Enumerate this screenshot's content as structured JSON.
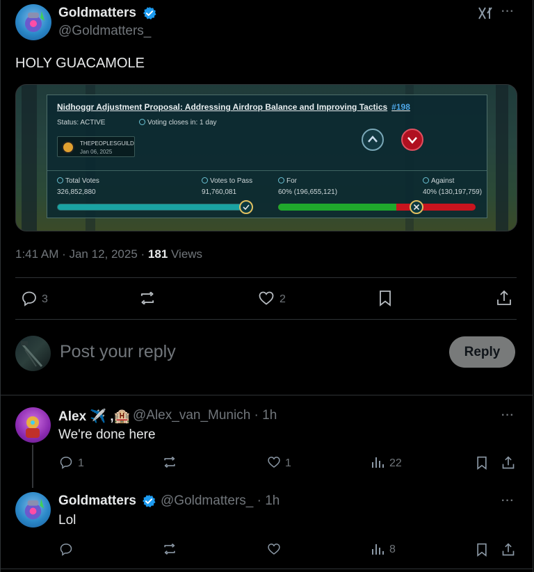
{
  "post": {
    "author_name": "Goldmatters",
    "author_handle": "@Goldmatters_",
    "text": "HOLY GUACAMOLE",
    "time": "1:41 AM · Jan 12, 2025 · ",
    "views_count": "181",
    "views_label": " Views",
    "replies": "3",
    "reposts": "",
    "likes": "2"
  },
  "proposal_card": {
    "title": "Nidhoggr Adjustment Proposal: Addressing Airdrop Balance and Improving Tactics",
    "number": "#198",
    "status": "Status: ACTIVE",
    "voting_closes": "Voting closes in: 1 day",
    "guild_name": "THEPEOPLESGUILD",
    "guild_date": "Jan 06, 2025",
    "total_votes_label": "Total Votes",
    "total_votes": "326,852,880",
    "votes_to_pass_label": "Votes to Pass",
    "votes_to_pass": "91,760,081",
    "for_label": "For",
    "for_value": "60% (196,655,121)",
    "against_label": "Against",
    "against_value": "40% (130,197,759)",
    "for_fraction": 0.6,
    "colors": {
      "for": "#1fa82c",
      "against": "#c8141e",
      "progress": "#1aa3a3"
    }
  },
  "reply_composer": {
    "placeholder": "Post your reply",
    "button": "Reply"
  },
  "replies": [
    {
      "author_name": "Alex ✈️ ,🏨",
      "author_handle": "@Alex_van_Munich",
      "time": "· 1h",
      "text": "We're done here",
      "replies": "1",
      "reposts": "",
      "likes": "1",
      "views": "22"
    },
    {
      "author_name": "Goldmatters",
      "author_handle": "@Goldmatters_",
      "time": "· 1h",
      "text": "Lol",
      "replies": "",
      "reposts": "",
      "likes": "",
      "views": "8"
    }
  ],
  "icons": {
    "verified": "verified-badge-icon",
    "grok": "grok-icon",
    "more": "more-icon",
    "reply": "reply-icon",
    "repost": "repost-icon",
    "like": "like-icon",
    "bookmark": "bookmark-icon",
    "share": "share-icon",
    "views": "views-icon"
  },
  "colors": {
    "verified": "#1d9bf0",
    "background": "#000000",
    "text": "#e7e9ea",
    "muted": "#71767b"
  }
}
